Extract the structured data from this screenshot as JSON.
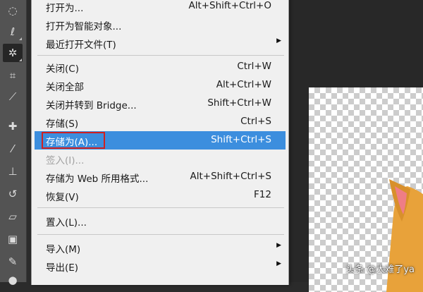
{
  "menu": {
    "items": [
      {
        "label": "打开为...",
        "shortcut": "Alt+Shift+Ctrl+O"
      },
      {
        "label": "打开为智能对象..."
      },
      {
        "label": "最近打开文件(T)",
        "submenu": "▶"
      },
      {
        "label": "关闭(C)",
        "shortcut": "Ctrl+W"
      },
      {
        "label": "关闭全部",
        "shortcut": "Alt+Ctrl+W"
      },
      {
        "label": "关闭并转到 Bridge...",
        "shortcut": "Shift+Ctrl+W"
      },
      {
        "label": "存储(S)",
        "shortcut": "Ctrl+S"
      },
      {
        "label": "存储为(A)...",
        "shortcut": "Shift+Ctrl+S"
      },
      {
        "label": "签入(I)..."
      },
      {
        "label": "存储为 Web 所用格式...",
        "shortcut": "Alt+Shift+Ctrl+S"
      },
      {
        "label": "恢复(V)",
        "shortcut": "F12"
      },
      {
        "label": "置入(L)..."
      },
      {
        "label": "导入(M)",
        "submenu": "▶"
      },
      {
        "label": "导出(E)",
        "submenu": "▶"
      }
    ],
    "highlighted_index": 7,
    "disabled_index": 8,
    "colors": {
      "highlight": "#3c8ede",
      "annotation_box": "#d02020",
      "menu_bg": "#f0f0f0"
    }
  },
  "toolbar": {
    "tools": [
      {
        "icon": "marquee-icon",
        "glyph": "◌"
      },
      {
        "icon": "lasso-icon",
        "glyph": "ℓ"
      },
      {
        "icon": "magic-wand-icon",
        "glyph": "✲"
      },
      {
        "icon": "crop-icon",
        "glyph": "⌗"
      },
      {
        "icon": "eyedropper-icon",
        "glyph": "⟋"
      },
      {
        "icon": "healing-brush-icon",
        "glyph": "✚"
      },
      {
        "icon": "brush-icon",
        "glyph": "⁄"
      },
      {
        "icon": "clone-stamp-icon",
        "glyph": "⊥"
      },
      {
        "icon": "history-brush-icon",
        "glyph": "↺"
      },
      {
        "icon": "eraser-icon",
        "glyph": "▱"
      },
      {
        "icon": "gradient-icon",
        "glyph": "▣"
      },
      {
        "icon": "blur-icon",
        "glyph": "✎"
      },
      {
        "icon": "dodge-icon",
        "glyph": "●"
      }
    ],
    "active_tool": "magic-wand-icon"
  },
  "watermark": {
    "text": "头条 @太难了ya"
  }
}
